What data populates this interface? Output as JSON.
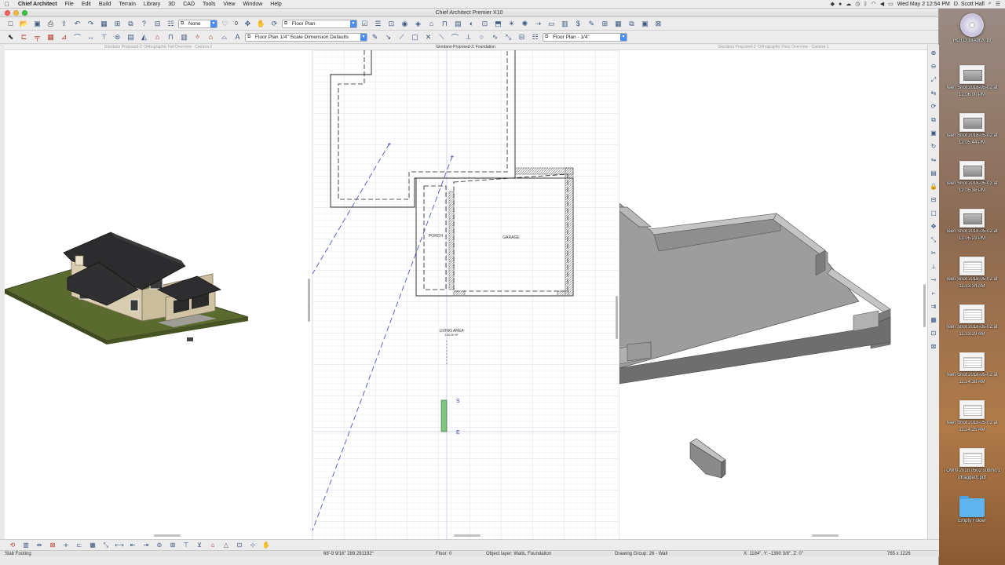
{
  "menubar": {
    "app_name": "Chief Architect",
    "items": [
      "File",
      "Edit",
      "Build",
      "Terrain",
      "Library",
      "3D",
      "CAD",
      "Tools",
      "View",
      "Window",
      "Help"
    ],
    "clock": "Wed May 2  12:54 PM",
    "user": "D. Scott Hall"
  },
  "window": {
    "title": "Chief Architect Premier X10",
    "toolbar1": {
      "layer_set": "None",
      "layer_count": "0",
      "plan_view": "Floor Plan"
    },
    "toolbar2": {
      "dimension_defaults": "Floor Plan 1/4\" Scale Dimension Defaults",
      "layer_view": "Floor Plan - 1/4\""
    }
  },
  "panes": {
    "left": {
      "title": "Giordano Proposed-2: Orthographic Full Overview - Camera 2"
    },
    "middle": {
      "title": "Giordano Proposed-2: Foundation",
      "rooms": {
        "porch": "PORCH",
        "garage": "GARAGE",
        "living": "LIVING AREA",
        "living_area_value": "100.50 ft²"
      },
      "markers": {
        "start": "S",
        "end": "E"
      }
    },
    "right": {
      "title": "Giordano Proposed-2: Orthographic Floor Overview - Camera 1"
    }
  },
  "statusbar": {
    "selected": "Slab Footing",
    "coords": "68'-9 9/16\" 289.291192°",
    "floor": "Floor: 0",
    "object_layer": "Object layer: Walls, Foundation",
    "drawing_group": "Drawing Group: 26 - Wall",
    "xyz": "X: 1184\", Y: -1390 3/8\", Z: 0\"",
    "size": "765 x 1226"
  },
  "desktop": {
    "items": [
      {
        "label1": "HOTO 18Apr2018",
        "label2": "",
        "kind": "disc"
      },
      {
        "label1": "reen Shot 2018-05-02 at",
        "label2": "12.06.00 PM",
        "kind": "screenshot"
      },
      {
        "label1": "reen Shot 2018-05-02 at",
        "label2": "12.05.44 PM",
        "kind": "screenshot"
      },
      {
        "label1": "reen Shot 2018-05-02 at",
        "label2": "12.05.36 PM",
        "kind": "screenshot"
      },
      {
        "label1": "reen Shot 2018-05-02 at",
        "label2": "12.05.23 PM",
        "kind": "screenshot"
      },
      {
        "label1": "reen Shot 2018-05-02 at",
        "label2": "11.33.34 AM",
        "kind": "doc"
      },
      {
        "label1": "reen Shot 2018-05-02 at",
        "label2": "11.33.29 AM",
        "kind": "doc"
      },
      {
        "label1": "reen Shot 2018-05-02 at",
        "label2": "11.24.38 AM",
        "kind": "doc"
      },
      {
        "label1": "reen Shot 2018-05-02 at",
        "label2": "11.24.25 AM",
        "kind": "doc"
      },
      {
        "label1": "TOWN 2018.0502 submit 1",
        "label2": "(dragged).pdf",
        "kind": "doc"
      },
      {
        "label1": "Empty Folder",
        "label2": "",
        "kind": "folder"
      }
    ]
  },
  "colors": {
    "accent": "#4a8df4",
    "plan_grid": "#e4e6f0",
    "terrain": "#5b6b30",
    "foundation_gray": "#9d9d9d",
    "selection_green": "#7fc47f"
  }
}
